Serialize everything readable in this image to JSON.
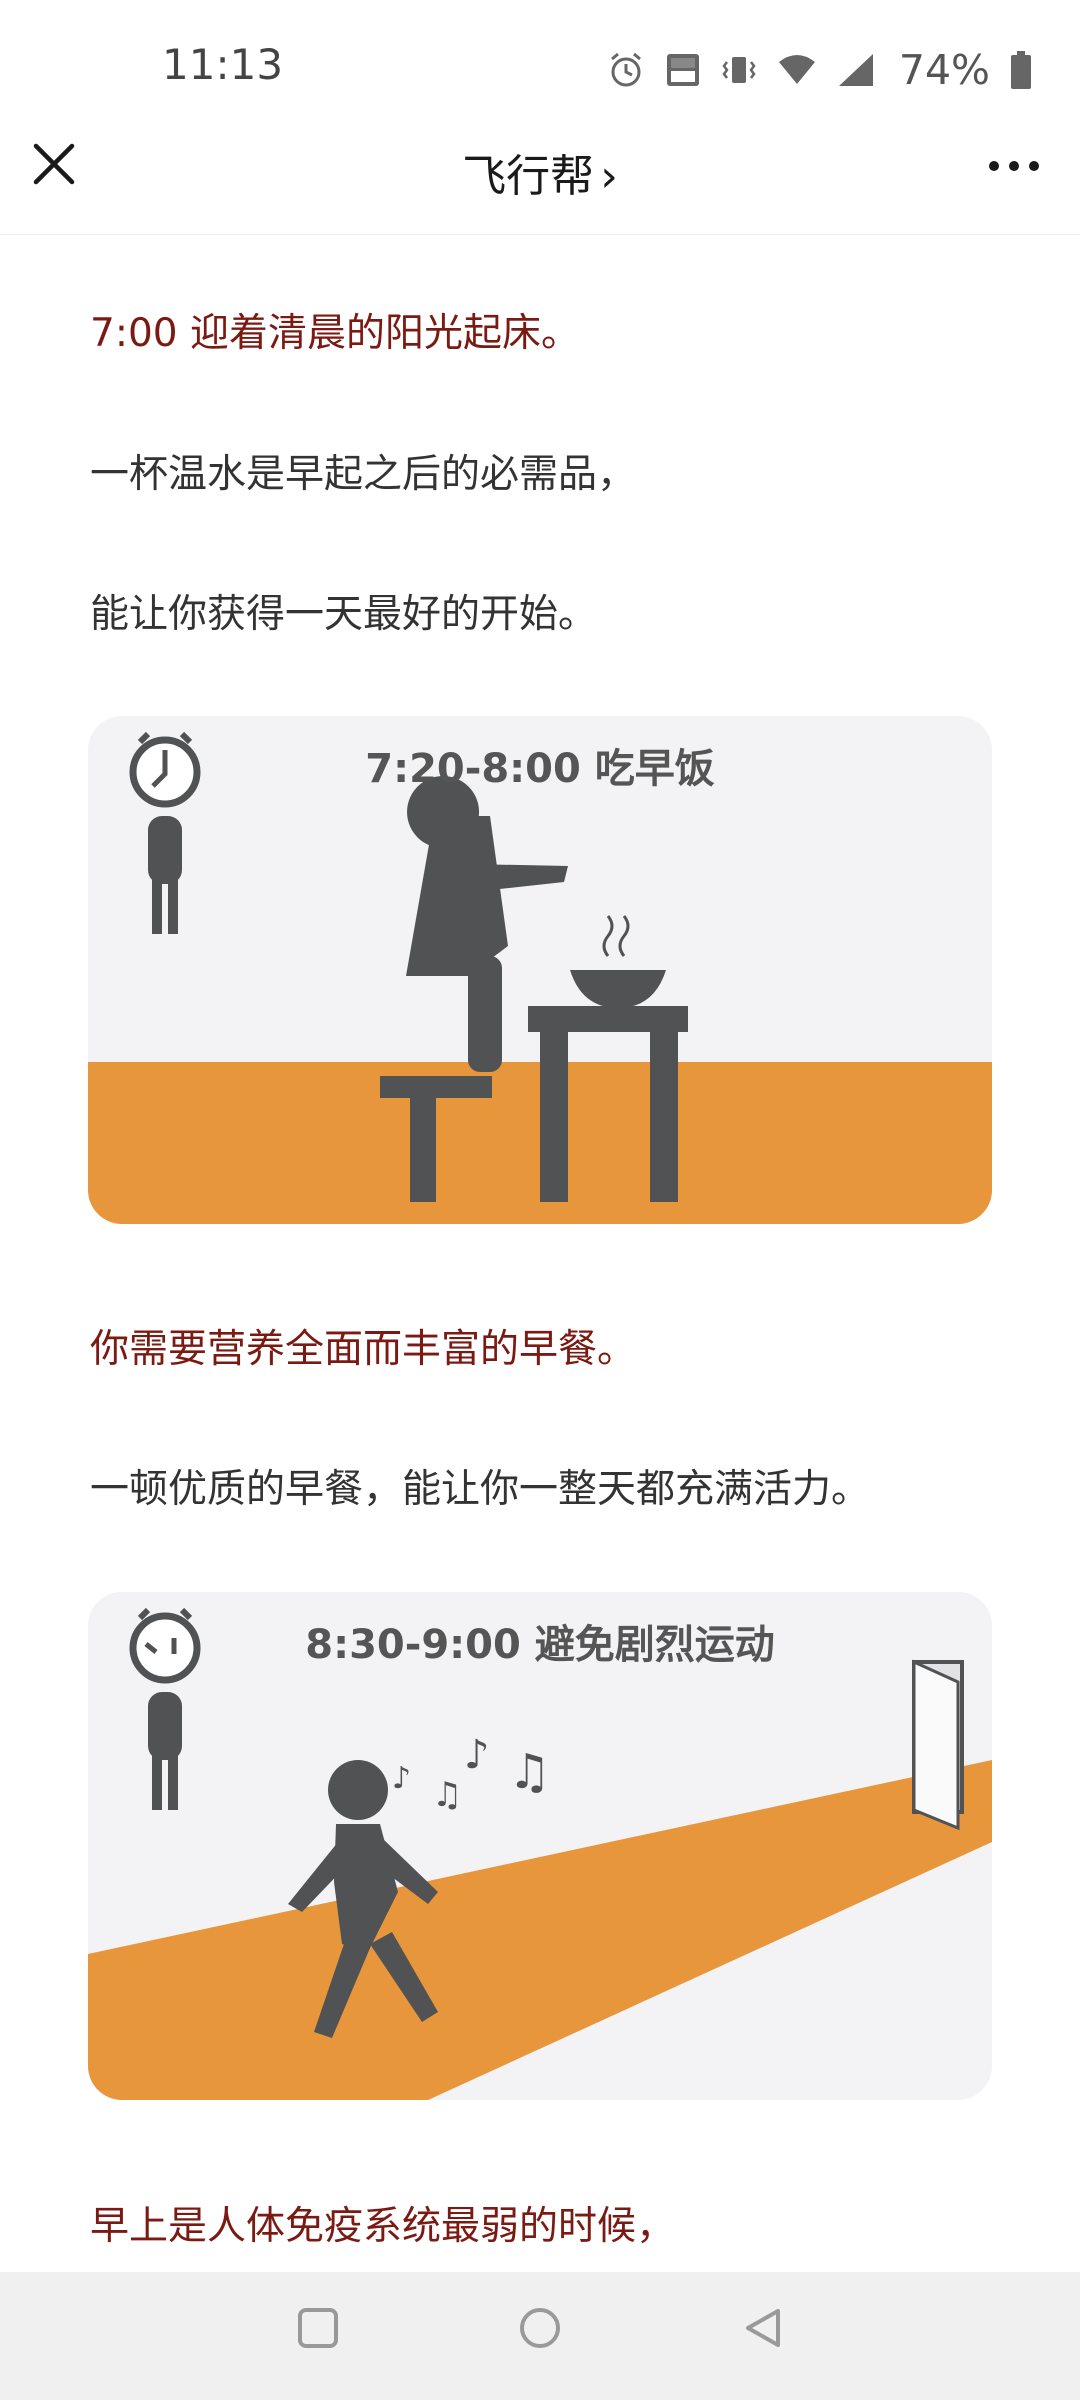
{
  "status_bar": {
    "time": "11:13",
    "battery_percent": "74%",
    "icons": [
      "alarm-icon",
      "volte-icon",
      "vibrate-icon",
      "wifi-icon",
      "signal-icon",
      "battery-icon"
    ]
  },
  "nav": {
    "title": "飞行帮",
    "chevron": "›",
    "close_icon": "close-icon",
    "more_icon": "more-icon"
  },
  "article": {
    "p1": "7:00 迎着清晨的阳光起床。",
    "p2": "一杯温水是早起之后的必需品，",
    "p3": "能让你获得一天最好的开始。",
    "illustration_1": {
      "title": "7:20-8:00 吃早饭"
    },
    "p4": "你需要营养全面而丰富的早餐。",
    "p5": "一顿优质的早餐，能让你一整天都充满活力。",
    "illustration_2": {
      "title": "8:30-9:00 避免剧烈运动"
    },
    "p6": "早上是人体免疫系统最弱的时候，"
  },
  "colors": {
    "accent_red": "#7b1a12",
    "orange": "#e8963c",
    "figure_gray": "#505254"
  },
  "system_nav": {
    "icons": [
      "recents-square-icon",
      "home-circle-icon",
      "back-triangle-icon"
    ]
  }
}
